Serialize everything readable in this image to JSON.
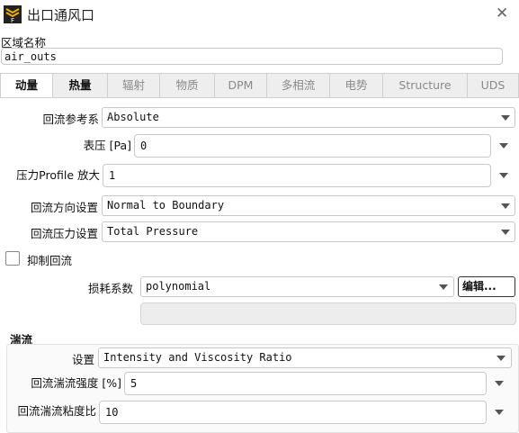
{
  "window": {
    "title": "出口通风口",
    "close_icon": "close-icon",
    "app_icon": "fluent-app-icon"
  },
  "zone": {
    "label": "区域名称",
    "value": "air_outs"
  },
  "tabs": [
    {
      "label": "动量"
    },
    {
      "label": "热量"
    },
    {
      "label": "辐射"
    },
    {
      "label": "物质"
    },
    {
      "label": "DPM"
    },
    {
      "label": "多相流"
    },
    {
      "label": "电势"
    },
    {
      "label": "Structure"
    },
    {
      "label": "UDS"
    }
  ],
  "momentum": {
    "backflow_ref": {
      "label": "回流参考系",
      "value": "Absolute"
    },
    "gauge_pressure": {
      "label": "表压 [Pa]",
      "value": "0"
    },
    "pressure_profile": {
      "label": "压力Profile 放大",
      "value": "1"
    },
    "backflow_direction": {
      "label": "回流方向设置",
      "value": "Normal to Boundary"
    },
    "backflow_pressure": {
      "label": "回流压力设置",
      "value": "Total Pressure"
    },
    "suppress_backflow": {
      "label": "抑制回流",
      "checked": false
    },
    "loss_coefficient": {
      "label": "损耗系数",
      "value": "polynomial",
      "edit_button": "编辑..."
    }
  },
  "turbulence": {
    "title": "湍流",
    "spec": {
      "label": "设置",
      "value": "Intensity and Viscosity Ratio"
    },
    "intensity": {
      "label": "回流湍流强度 [%]",
      "value": "5"
    },
    "viscosity_ratio": {
      "label": "回流湍流粘度比",
      "value": "10"
    }
  }
}
